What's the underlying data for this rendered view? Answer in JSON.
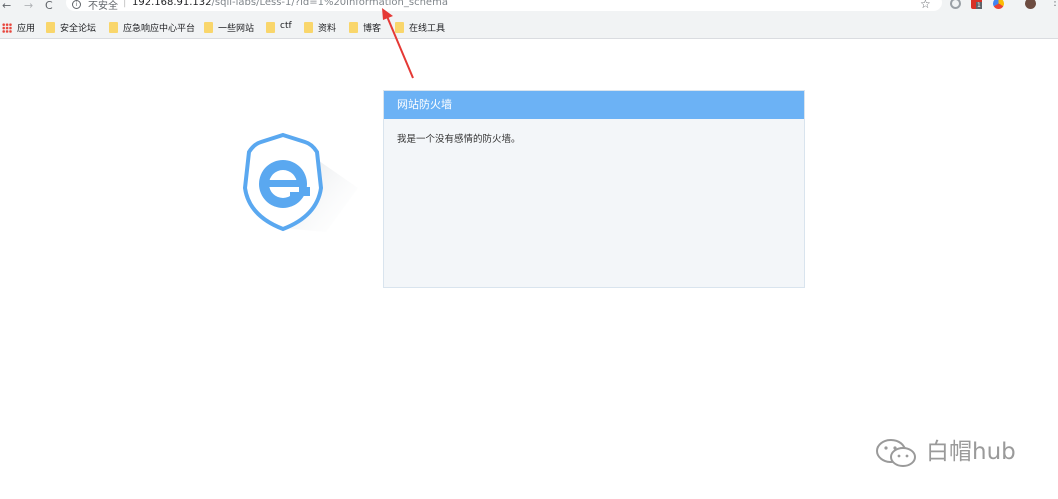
{
  "browser": {
    "security_label": "不安全",
    "url_separator": "|",
    "url_host": "192.168.91.132",
    "url_path": "/sqli-labs/Less-1/?id=1%20information_schema",
    "extension_badge": "1"
  },
  "bookmarks": {
    "apps_label": "应用",
    "items": [
      {
        "label": "安全论坛"
      },
      {
        "label": "应急响应中心平台"
      },
      {
        "label": "一些网站"
      },
      {
        "label": "ctf"
      },
      {
        "label": "资料"
      },
      {
        "label": "博客"
      },
      {
        "label": "在线工具"
      }
    ]
  },
  "waf": {
    "title": "网站防火墙",
    "message": "我是一个没有感情的防火墙。"
  },
  "watermark": {
    "text": "白帽hub"
  },
  "colors": {
    "waf_header": "#6cb2f5",
    "logo_blue": "#5aa8f0",
    "annotation_arrow": "#e53935"
  },
  "icons": {
    "logo": "shield-e-logo-icon",
    "watermark": "wechat-icon"
  }
}
